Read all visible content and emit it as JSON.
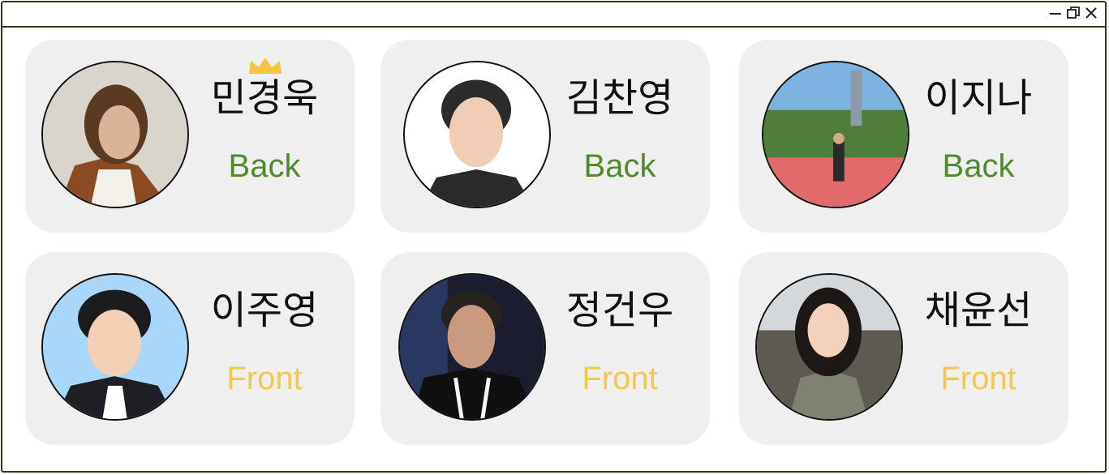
{
  "window": {
    "controls": [
      "minimize-icon",
      "restore-icon",
      "close-icon"
    ]
  },
  "colors": {
    "back": "#4f8a2b",
    "front": "#f2c94c",
    "card": "#efefef",
    "border": "#2e3a1c",
    "crown": "#f5c542"
  },
  "members": [
    {
      "name": "민경욱",
      "role": "Back",
      "leader_icon": "crown-icon"
    },
    {
      "name": "김찬영",
      "role": "Back"
    },
    {
      "name": "이지나",
      "role": "Back"
    },
    {
      "name": "이주영",
      "role": "Front"
    },
    {
      "name": "정건우",
      "role": "Front"
    },
    {
      "name": "채윤선",
      "role": "Front"
    }
  ]
}
